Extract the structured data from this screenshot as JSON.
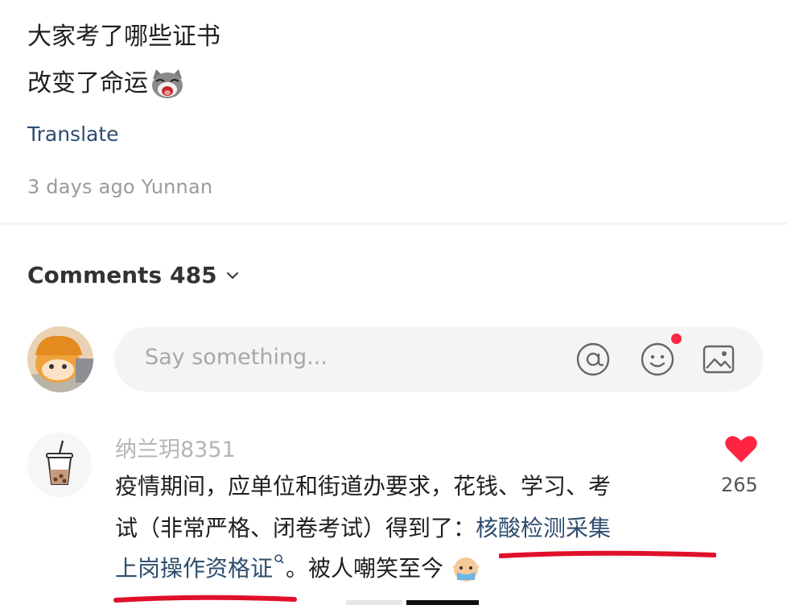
{
  "post": {
    "line1": "大家考了哪些证书",
    "line2": "改变了命运",
    "translate_label": "Translate",
    "meta": "3 days ago Yunnan"
  },
  "comments_section": {
    "title": "Comments",
    "count": "485"
  },
  "comment_input": {
    "placeholder": "Say something..."
  },
  "icons": {
    "at": "at-icon",
    "emoji": "emoji-icon",
    "image": "image-icon",
    "heart": "heart-icon"
  },
  "colors": {
    "accent_red": "#ff2442",
    "link_blue": "#2e4d6e",
    "muted_gray": "#9a9a9a"
  },
  "comment": {
    "username": "纳兰玥8351",
    "line1": "疫情期间，应单位和街道办要求，花钱、学习、考",
    "line2_plain": "试（非常严格、闭卷考试）得到了：",
    "line2_link": "核酸检测采集",
    "line3_link": "上岗操作资格证",
    "line3_plain": "。被人嘲笑至今",
    "likes": "265"
  }
}
